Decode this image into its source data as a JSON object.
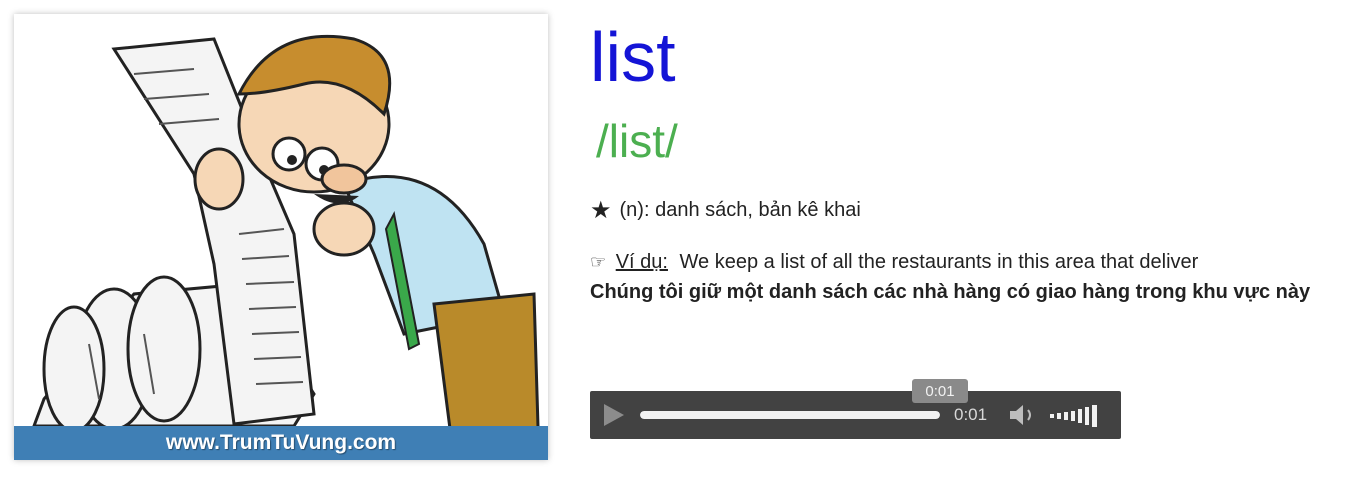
{
  "image": {
    "watermark": "www.TrumTuVung.com",
    "alt": "man reading a long list illustration"
  },
  "entry": {
    "word": "list",
    "ipa": "/list/",
    "definition": "(n): danh sách, bản kê khai",
    "example_label": "Ví dụ:",
    "example_en": "We keep a list of all the restaurants in this area that deliver",
    "example_vi": "Chúng tôi giữ một danh sách các nhà hàng có giao hàng trong khu vực này"
  },
  "player": {
    "tooltip_time": "0:01",
    "current_time": "0:01",
    "progress": 1.0,
    "icons": {
      "play": "play-icon",
      "volume": "volume-icon",
      "volume_level": "volume-level-icon"
    }
  },
  "colors": {
    "word": "#1414d6",
    "ipa": "#4caf50",
    "watermark_bar": "#3f7fb5",
    "player_bg": "#424242"
  }
}
